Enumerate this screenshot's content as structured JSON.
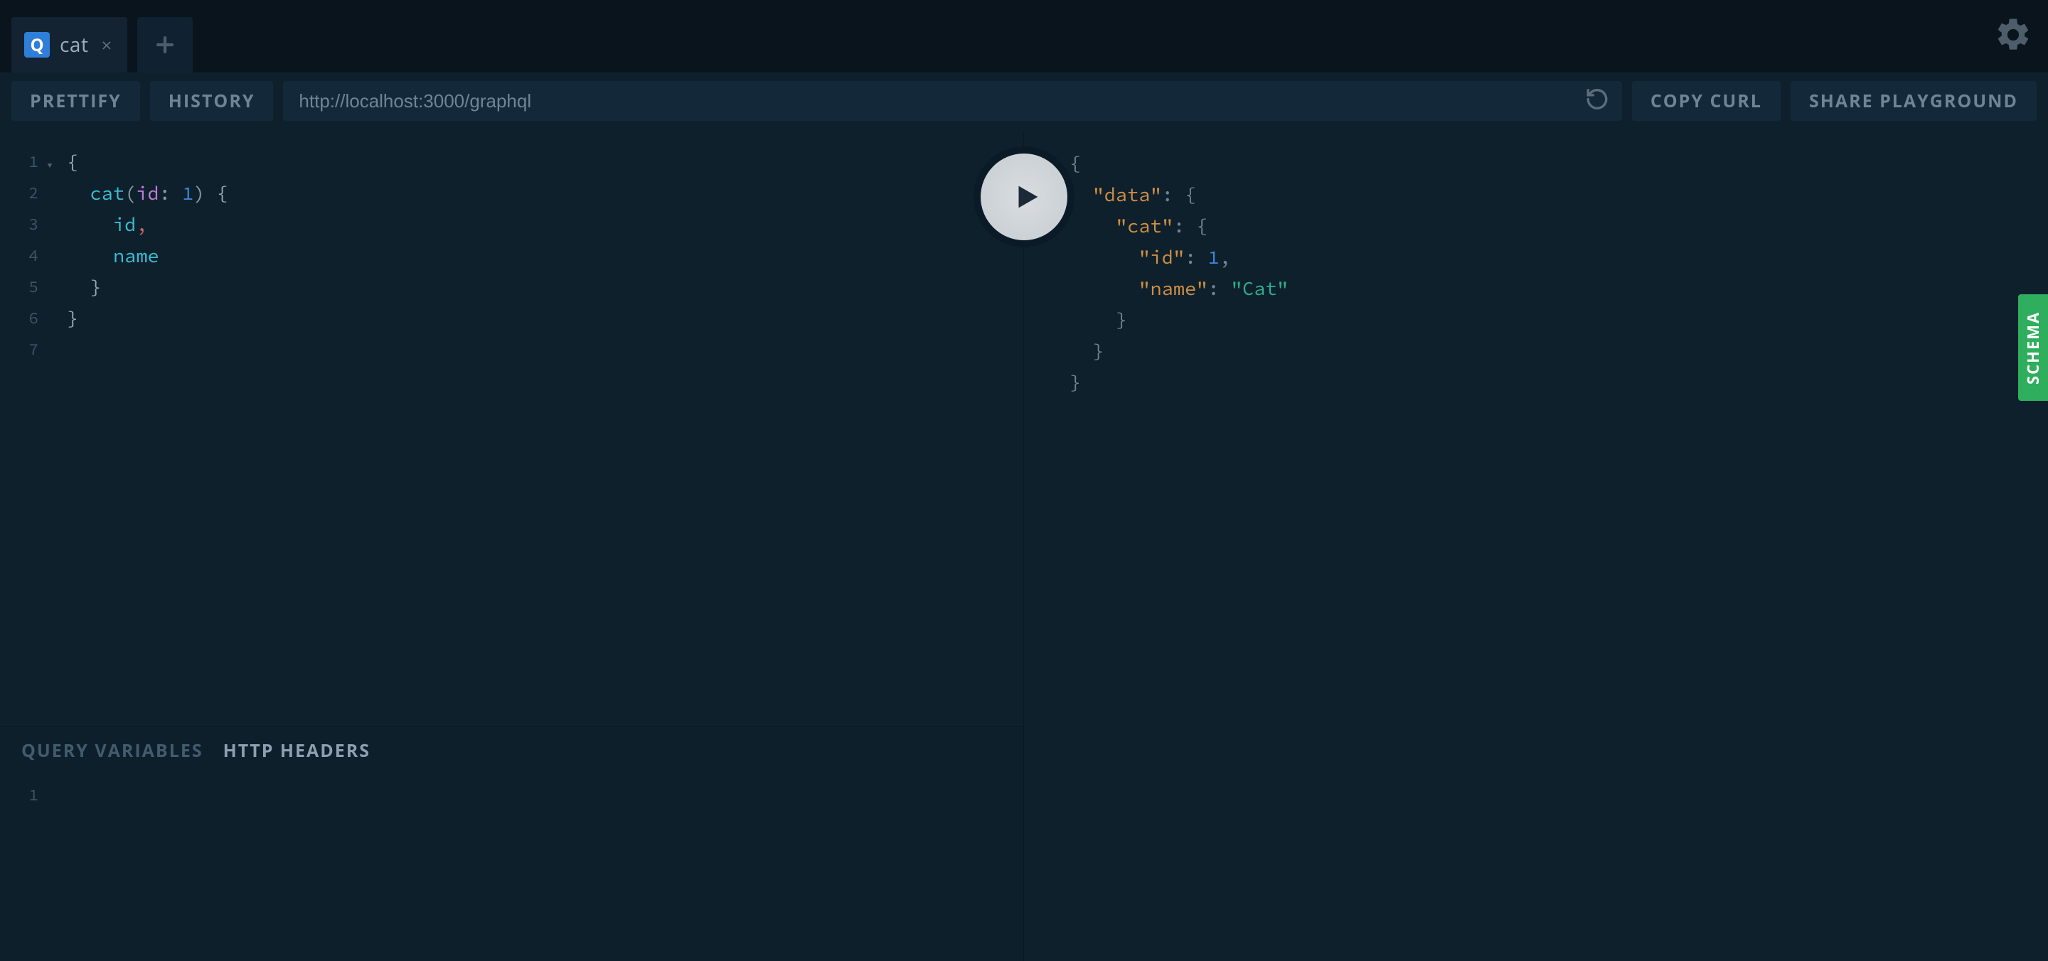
{
  "tabs": {
    "badge": "Q",
    "label": "cat"
  },
  "toolbar": {
    "prettify": "PRETTIFY",
    "history": "HISTORY",
    "endpoint": "http://localhost:3000/graphql",
    "copyCurl": "COPY CURL",
    "share": "SHARE PLAYGROUND"
  },
  "query": {
    "lines": [
      {
        "n": "1",
        "t": "{"
      },
      {
        "n": "2",
        "t": "  cat(id: 1) {"
      },
      {
        "n": "3",
        "t": "    id,"
      },
      {
        "n": "4",
        "t": "    name"
      },
      {
        "n": "5",
        "t": "  }"
      },
      {
        "n": "6",
        "t": "}"
      },
      {
        "n": "7",
        "t": ""
      }
    ]
  },
  "bottom": {
    "tabVariables": "QUERY VARIABLES",
    "tabHeaders": "HTTP HEADERS",
    "activeTab": "headers",
    "line1": "1"
  },
  "result": {
    "data": {
      "cat": {
        "id": 1,
        "name": "Cat"
      }
    }
  },
  "schemaLabel": "SCHEMA"
}
